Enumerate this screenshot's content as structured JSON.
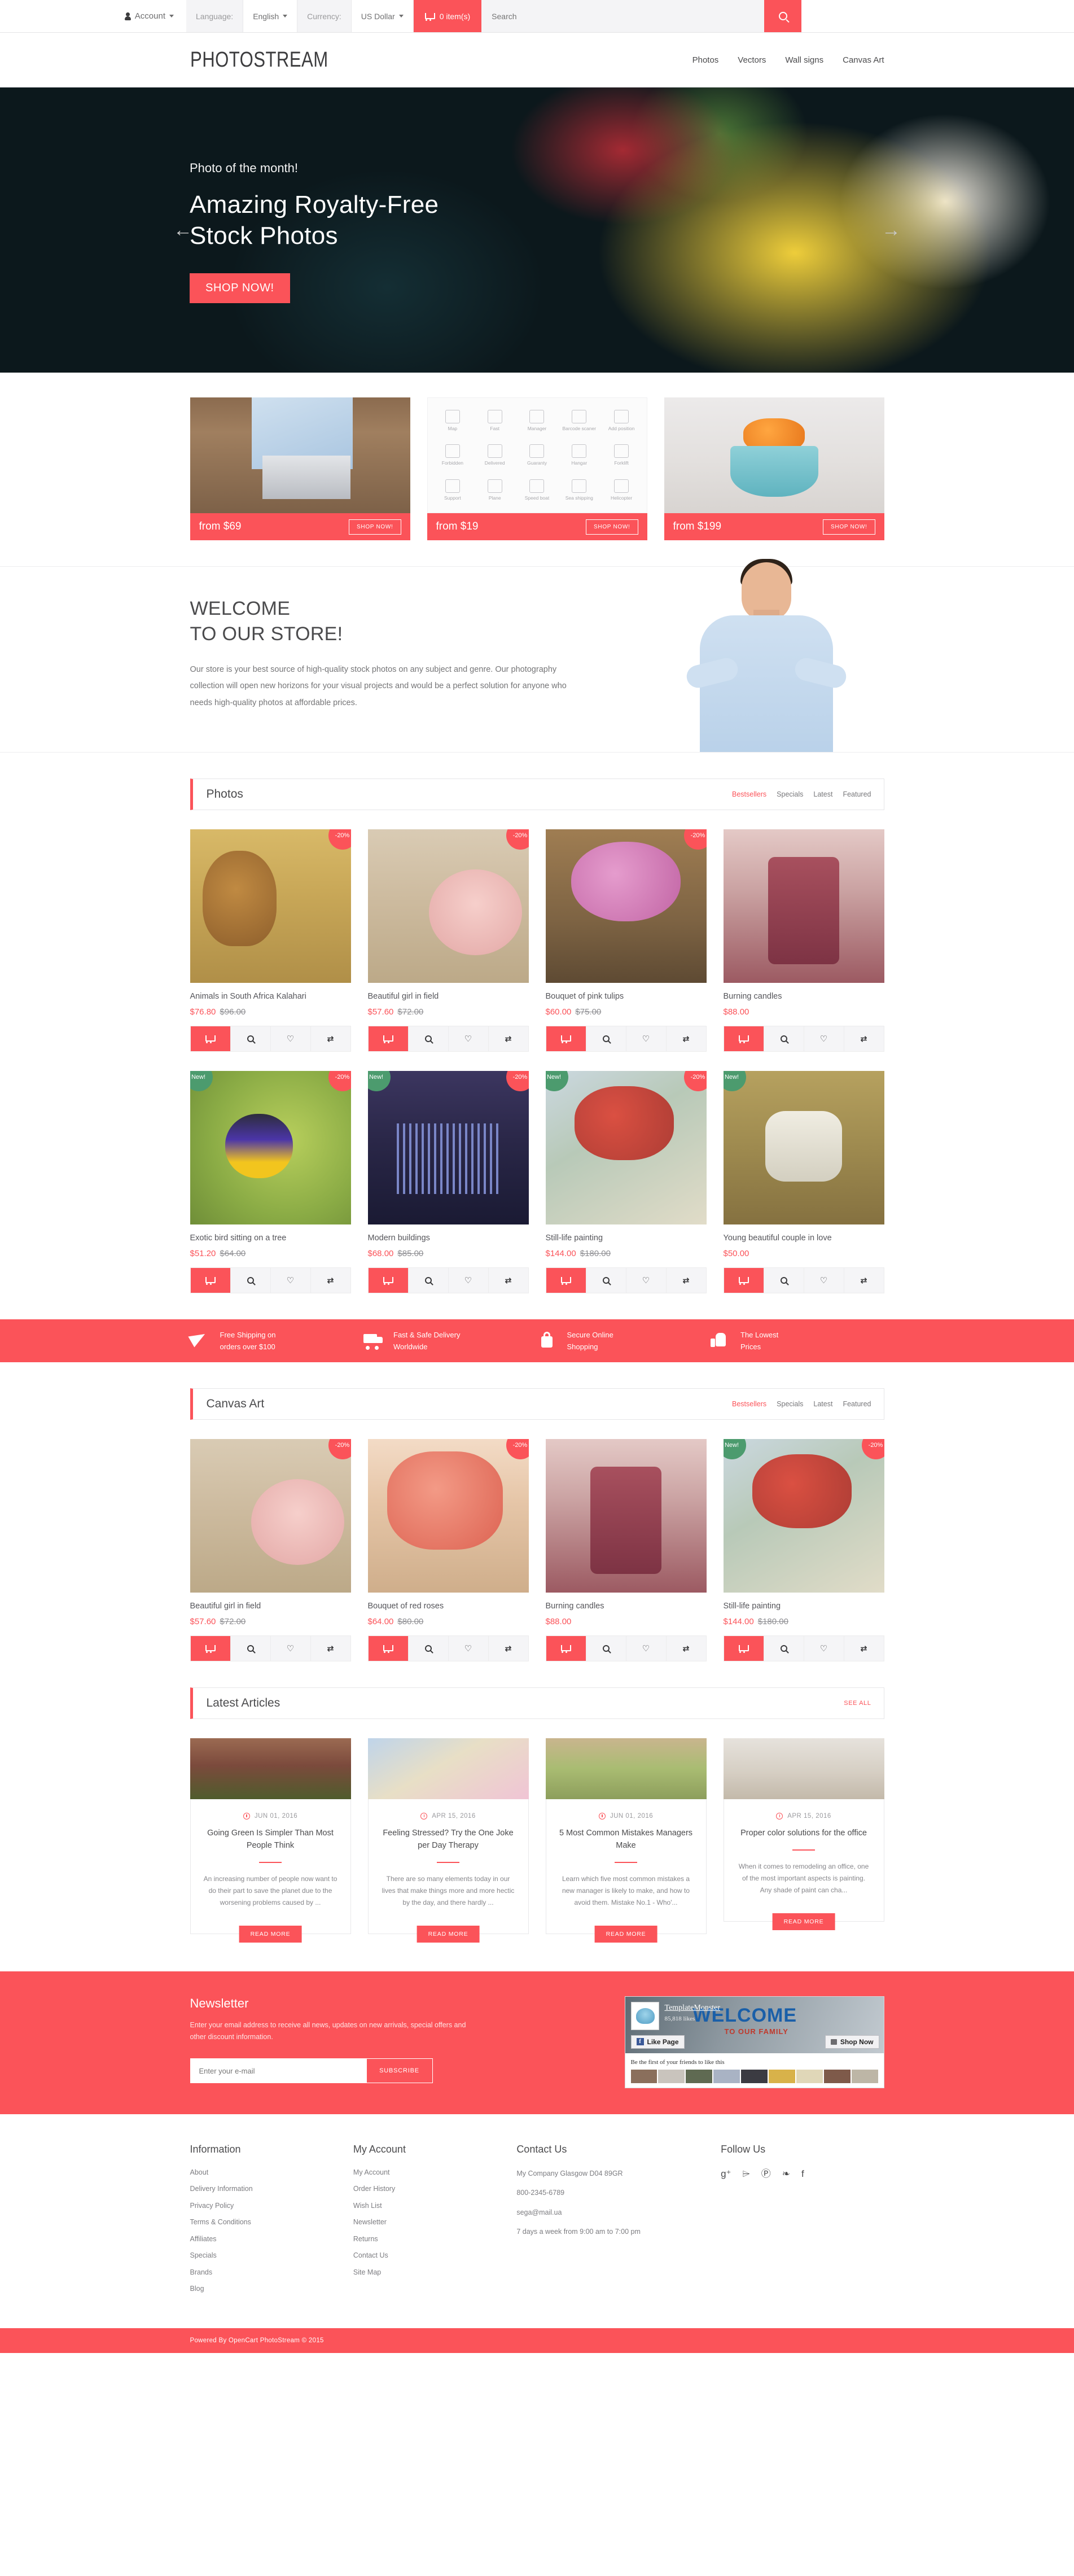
{
  "topbar": {
    "account_label": "Account",
    "language_label": "Language:",
    "language_value": "English",
    "currency_label": "Currency:",
    "currency_value": "US Dollar",
    "cart_label": "0 item(s)",
    "search_placeholder": "Search",
    "search_value": ""
  },
  "header": {
    "logo": "PHOTOSTREAM",
    "nav": [
      {
        "label": "Photos"
      },
      {
        "label": "Vectors"
      },
      {
        "label": "Wall signs"
      },
      {
        "label": "Canvas Art"
      }
    ]
  },
  "hero": {
    "kicker": "Photo of the month!",
    "title_line1": "Amazing Royalty-Free",
    "title_line2": "Stock Photos",
    "button": "SHOP NOW!",
    "arrow_left": "←",
    "arrow_right": "→"
  },
  "promos": [
    {
      "price": "from $69",
      "button": "SHOP NOW!"
    },
    {
      "price": "from $19",
      "button": "SHOP NOW!"
    },
    {
      "price": "from $199",
      "button": "SHOP NOW!"
    }
  ],
  "promo_icon_labels": [
    "Map",
    "Fast",
    "Manager",
    "Barcode scaner",
    "Add position",
    "Forbidden",
    "Delivered",
    "Guaranty",
    "Hangar",
    "Forklift",
    "Support",
    "Plane",
    "Speed boat",
    "Sea shipping",
    "Helicopter"
  ],
  "welcome": {
    "heading_line1": "WELCOME",
    "heading_line2": "TO OUR STORE!",
    "paragraph": "Our store is your best source of high-quality stock photos on any subject and genre. Our photography collection will open new horizons for your visual projects and would be a perfect solution for anyone who needs high-quality photos at affordable prices."
  },
  "photos_section": {
    "title": "Photos",
    "tabs": [
      "Bestsellers",
      "Specials",
      "Latest",
      "Featured"
    ],
    "active_tab": "Bestsellers",
    "products": [
      {
        "name": "Animals in South Africa Kalahari",
        "price": "$76.80",
        "old_price": "$96.00",
        "badge": "-20%",
        "badge_type": "sale",
        "art": "im-lion"
      },
      {
        "name": "Beautiful girl in field",
        "price": "$57.60",
        "old_price": "$72.00",
        "badge": "-20%",
        "badge_type": "sale",
        "art": "im-girl"
      },
      {
        "name": "Bouquet of pink tulips",
        "price": "$60.00",
        "old_price": "$75.00",
        "badge": "-20%",
        "badge_type": "sale",
        "art": "im-tulip"
      },
      {
        "name": "Burning candles",
        "price": "$88.00",
        "old_price": "",
        "badge": "",
        "badge_type": "",
        "art": "im-candle"
      },
      {
        "name": "Exotic bird sitting on a tree",
        "price": "$51.20",
        "old_price": "$64.00",
        "badge": "-20%",
        "badge_type": "sale",
        "badge2": "New!",
        "art": "im-bird"
      },
      {
        "name": "Modern buildings",
        "price": "$68.00",
        "old_price": "$85.00",
        "badge": "-20%",
        "badge_type": "sale",
        "badge2": "New!",
        "art": "im-city"
      },
      {
        "name": "Still-life painting",
        "price": "$144.00",
        "old_price": "$180.00",
        "badge": "-20%",
        "badge_type": "sale",
        "badge2": "New!",
        "art": "im-still"
      },
      {
        "name": "Young beautiful couple in love",
        "price": "$50.00",
        "old_price": "",
        "badge": "",
        "badge_type": "",
        "badge2": "New!",
        "art": "im-couple"
      }
    ]
  },
  "services": [
    {
      "line1": "Free Shipping on",
      "line2": "orders over $100",
      "icon": "plane-icon"
    },
    {
      "line1": "Fast & Safe Delivery",
      "line2": "Worldwide",
      "icon": "truck-icon"
    },
    {
      "line1": "Secure Online",
      "line2": "Shopping",
      "icon": "lock-icon"
    },
    {
      "line1": "The Lowest",
      "line2": "Prices",
      "icon": "thumbs-up-icon"
    }
  ],
  "canvas_section": {
    "title": "Canvas Art",
    "tabs": [
      "Bestsellers",
      "Specials",
      "Latest",
      "Featured"
    ],
    "active_tab": "Bestsellers",
    "products": [
      {
        "name": "Beautiful girl in field",
        "price": "$57.60",
        "old_price": "$72.00",
        "badge": "-20%",
        "badge_type": "sale",
        "art": "im-girl"
      },
      {
        "name": "Bouquet of red roses",
        "price": "$64.00",
        "old_price": "$80.00",
        "badge": "-20%",
        "badge_type": "sale",
        "art": "im-roses"
      },
      {
        "name": "Burning candles",
        "price": "$88.00",
        "old_price": "",
        "badge": "",
        "badge_type": "",
        "art": "im-candle"
      },
      {
        "name": "Still-life painting",
        "price": "$144.00",
        "old_price": "$180.00",
        "badge": "-20%",
        "badge_type": "sale",
        "badge2": "New!",
        "art": "im-still"
      }
    ]
  },
  "articles_section": {
    "title": "Latest Articles",
    "see_all": "SEE ALL",
    "articles": [
      {
        "date": "JUN 01, 2016",
        "title": "Going Green Is Simpler Than Most People Think",
        "excerpt": "An increasing number of people now want to do their part to save the planet due to the worsening problems caused by ...",
        "button": "READ MORE",
        "art": "a1"
      },
      {
        "date": "APR 15, 2016",
        "title": "Feeling Stressed? Try the One Joke per Day Therapy",
        "excerpt": "There are so many elements today in our lives that make things more and more hectic by the day, and there hardly ...",
        "button": "READ MORE",
        "art": "a2"
      },
      {
        "date": "JUN 01, 2016",
        "title": "5 Most Common Mistakes Managers Make",
        "excerpt": "Learn which five most common mistakes a new manager is likely to make, and how to avoid them. Mistake No.1 - Who'...",
        "button": "READ MORE",
        "art": "a3"
      },
      {
        "date": "APR 15, 2016",
        "title": "Proper color solutions for the office",
        "excerpt": "When it comes to remodeling an office, one of the most important aspects is painting. Any shade of paint can cha...",
        "button": "READ MORE",
        "art": "a4"
      }
    ]
  },
  "newsletter": {
    "heading": "Newsletter",
    "description": "Enter your email address to receive all news, updates on new arrivals, special offers and other discount information.",
    "input_placeholder": "Enter your e-mail",
    "input_value": "",
    "button": "SUBSCRIBE"
  },
  "facebook": {
    "page_name": "TemplateMonster",
    "likes": "85,818 likes",
    "cover_title": "WELCOME",
    "cover_subtitle": "TO OUR FAMILY",
    "like_button": "Like Page",
    "shop_button": "Shop Now",
    "body_text": "Be the first of your friends to like this"
  },
  "footer": {
    "columns": [
      {
        "title": "Information",
        "links": [
          "About",
          "Delivery Information",
          "Privacy Policy",
          "Terms & Conditions",
          "Affiliates",
          "Specials",
          "Brands",
          "Blog"
        ]
      },
      {
        "title": "My Account",
        "links": [
          "My Account",
          "Order History",
          "Wish List",
          "Newsletter",
          "Returns",
          "Contact Us",
          "Site Map"
        ]
      }
    ],
    "contact": {
      "title": "Contact Us",
      "address": "My Company Glasgow D04 89GR",
      "phone": "800-2345-6789",
      "email": "sega@mail.ua",
      "hours": "7 days a week from 9:00 am to 7:00 pm"
    },
    "follow": {
      "title": "Follow Us",
      "icons": [
        "google-plus-icon",
        "rss-icon",
        "pinterest-icon",
        "twitter-icon",
        "facebook-icon"
      ],
      "glyphs": [
        "g⁺",
        "⌲",
        "Ⓟ",
        "❧",
        "f"
      ]
    },
    "copyright": "Powered By OpenCart PhotoStream © 2015"
  },
  "colors": {
    "accent": "#fb5359",
    "new_badge": "#4c9b6e",
    "text": "#55555a"
  }
}
